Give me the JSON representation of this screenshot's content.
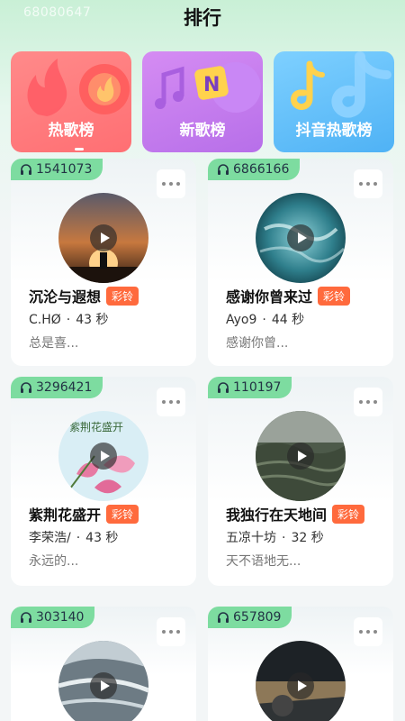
{
  "watermark": "68080647",
  "page_title": "排行",
  "categories": [
    {
      "label": "热歌榜",
      "icon": "flame-icon",
      "color": "#ff7a7e"
    },
    {
      "label": "新歌榜",
      "icon": "music-note-icon",
      "color": "#c57df0"
    },
    {
      "label": "抖音热歌榜",
      "icon": "douyin-note-icon",
      "color": "#5dbaf7"
    }
  ],
  "songs": [
    {
      "plays": "1541073",
      "title": "沉沦与遐想",
      "badge": "彩铃",
      "artist": "C.HØ",
      "duration": "43 秒",
      "lyric": "总是喜..."
    },
    {
      "plays": "6866166",
      "title": "感谢你曾来过",
      "badge": "彩铃",
      "artist": "Ayo9",
      "duration": "44 秒",
      "lyric": "感谢你曾..."
    },
    {
      "plays": "3296421",
      "title": "紫荆花盛开",
      "badge": "彩铃",
      "artist": "李荣浩/",
      "duration": "43 秒",
      "lyric": "永远的..."
    },
    {
      "plays": "110197",
      "title": "我独行在天地间",
      "badge": "彩铃",
      "artist": "五凉十坊",
      "duration": "32 秒",
      "lyric": "天不语地无..."
    },
    {
      "plays": "303140"
    },
    {
      "plays": "657809"
    }
  ],
  "cover_text": {
    "song3": "紫荆花盛开"
  },
  "meta_separator": "·",
  "accent_colors": {
    "plays_badge": "#7ddca0",
    "ring_badge": "#ff6a3d"
  }
}
